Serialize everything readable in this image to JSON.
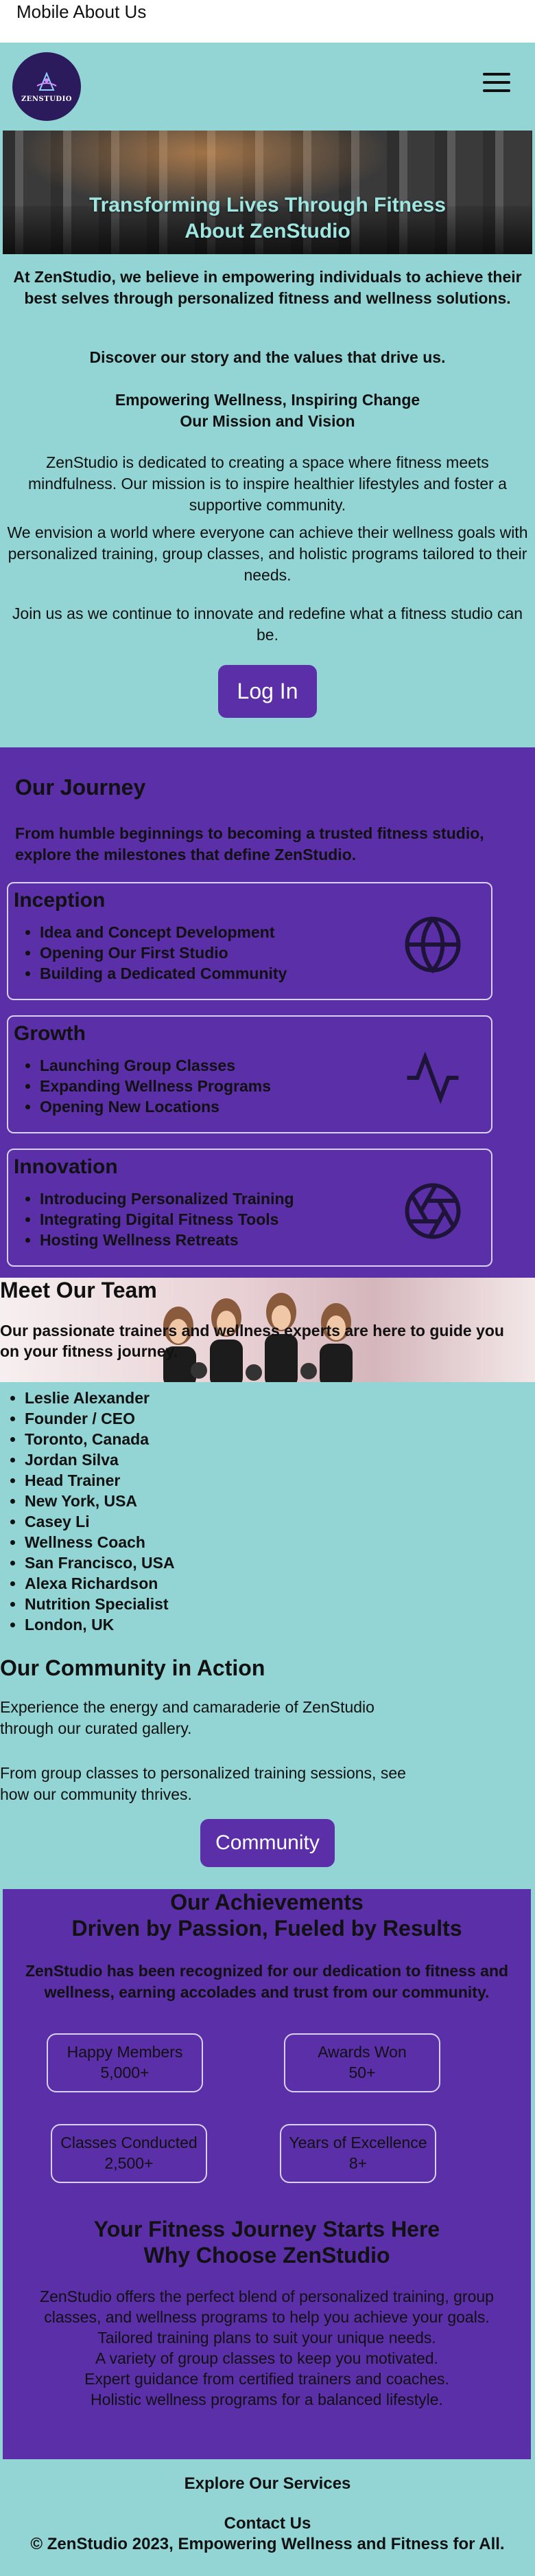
{
  "page_title": "Mobile About Us",
  "logo_text": "ZENSTUDIO",
  "hero_title_1": "Transforming Lives Through Fitness",
  "hero_title_2": "About ZenStudio",
  "intro": {
    "p1": "At ZenStudio, we believe in empowering individuals to achieve their best selves through personalized fitness and wellness solutions.",
    "p2": "Discover our story and the values that drive us.",
    "p3_line1": "Empowering Wellness, Inspiring Change",
    "p3_line2": "Our Mission and Vision",
    "p4": "ZenStudio is dedicated to creating a space where fitness meets mindfulness. Our mission is to inspire healthier lifestyles and foster a supportive community.",
    "p5": "We envision a world where everyone can achieve their wellness goals with personalized training, group classes, and holistic programs tailored to their needs.",
    "p6": "Join us as we continue to innovate and redefine what a fitness studio can be.",
    "login": "Log In"
  },
  "journey": {
    "title": "Our Journey",
    "lead": "From humble beginnings to becoming a trusted fitness studio, explore the milestones that define ZenStudio.",
    "cards": [
      {
        "title": "Inception",
        "items": [
          "Idea and Concept Development",
          "Opening Our First Studio",
          "Building a Dedicated Community"
        ],
        "icon": "globe-icon"
      },
      {
        "title": "Growth",
        "items": [
          "Launching Group Classes",
          "Expanding Wellness Programs",
          "Opening New Locations"
        ],
        "icon": "activity-icon"
      },
      {
        "title": "Innovation",
        "items": [
          "Introducing Personalized Training",
          "Integrating Digital Fitness Tools",
          "Hosting Wellness Retreats"
        ],
        "icon": "aperture-icon"
      }
    ]
  },
  "team": {
    "title": "Meet Our Team",
    "lead": "Our passionate trainers and wellness experts are here to guide you on your fitness journey.",
    "list": [
      "Leslie Alexander",
      "Founder / CEO",
      "Toronto, Canada",
      "Jordan Silva",
      "Head Trainer",
      "New York, USA",
      "Casey Li",
      "Wellness Coach",
      "San Francisco, USA",
      "Alexa Richardson",
      "Nutrition Specialist",
      "London, UK"
    ]
  },
  "community": {
    "title": "Our Community in Action",
    "p1": "Experience the energy and camaraderie of ZenStudio through our curated gallery.",
    "p2": "From group classes to personalized training sessions, see how our community thrives.",
    "button": "Community"
  },
  "achievements": {
    "title_1": "Our Achievements",
    "title_2": "Driven by Passion, Fueled by Results",
    "lead": "ZenStudio has been recognized for our dedication to fitness and wellness, earning accolades and trust from our community.",
    "stats": [
      {
        "label": "Happy Members",
        "value": "5,000+"
      },
      {
        "label": "Awards Won",
        "value": "50+"
      },
      {
        "label": "Classes Conducted",
        "value": "2,500+"
      },
      {
        "label": "Years of Excellence",
        "value": "8+"
      }
    ],
    "why_1": "Your Fitness Journey Starts Here",
    "why_2": "Why Choose ZenStudio",
    "why_p": "ZenStudio offers the perfect blend of personalized training, group classes, and wellness programs to help you achieve your goals.",
    "why_l1": "Tailored training plans to suit your unique needs.",
    "why_l2": "A variety of group classes to keep you motivated.",
    "why_l3": "Expert guidance from certified trainers and coaches.",
    "why_l4": "Holistic wellness programs for a balanced lifestyle."
  },
  "footer": {
    "services": "Explore Our Services",
    "contact": "Contact Us",
    "copyright": "© ZenStudio 2023, Empowering Wellness and Fitness for All."
  },
  "colors": {
    "teal": "#92d5d4",
    "purple": "#5a2fa8",
    "logo_bg": "#2b1b5c"
  }
}
